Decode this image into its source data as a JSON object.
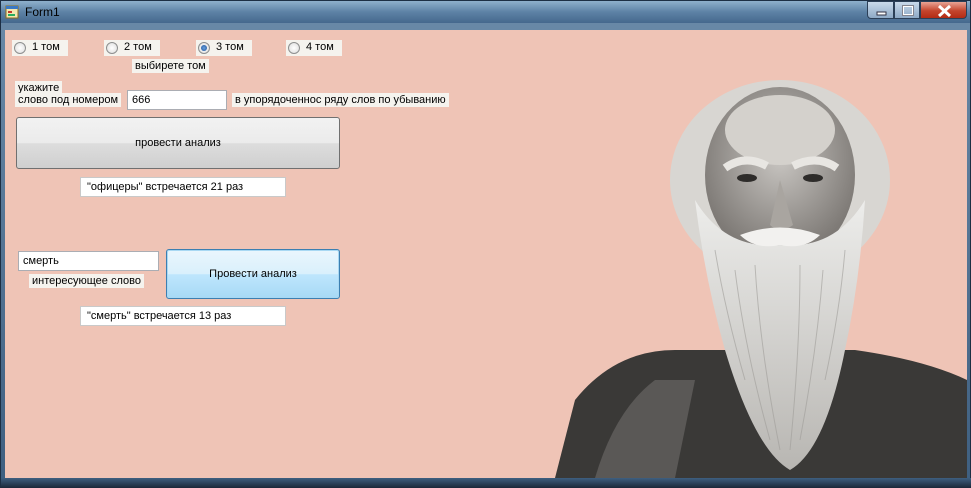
{
  "window": {
    "title": "Form1",
    "icon": "form-app-icon",
    "controls": [
      "minimize-icon",
      "maximize-icon",
      "close-icon"
    ]
  },
  "volumes": {
    "options": [
      "1 том",
      "2 том",
      "3 том",
      "4 том"
    ],
    "selected": "3 том",
    "caption": "выбирете том"
  },
  "rank_analysis": {
    "label_line1": "укажите",
    "label_line2": "слово под номером",
    "number_value": "666",
    "suffix_label": "в упорядоченнос ряду слов по убыванию",
    "button_label": "провести анализ",
    "result_text": "\"офицеры\" встречается 21 раз"
  },
  "word_analysis": {
    "word_value": "смерть",
    "word_caption": "интересующее слово",
    "button_label": "Провести анализ",
    "result_text": "\"смерть\" встречается 13 раз"
  },
  "background_image": "portrait-photo"
}
